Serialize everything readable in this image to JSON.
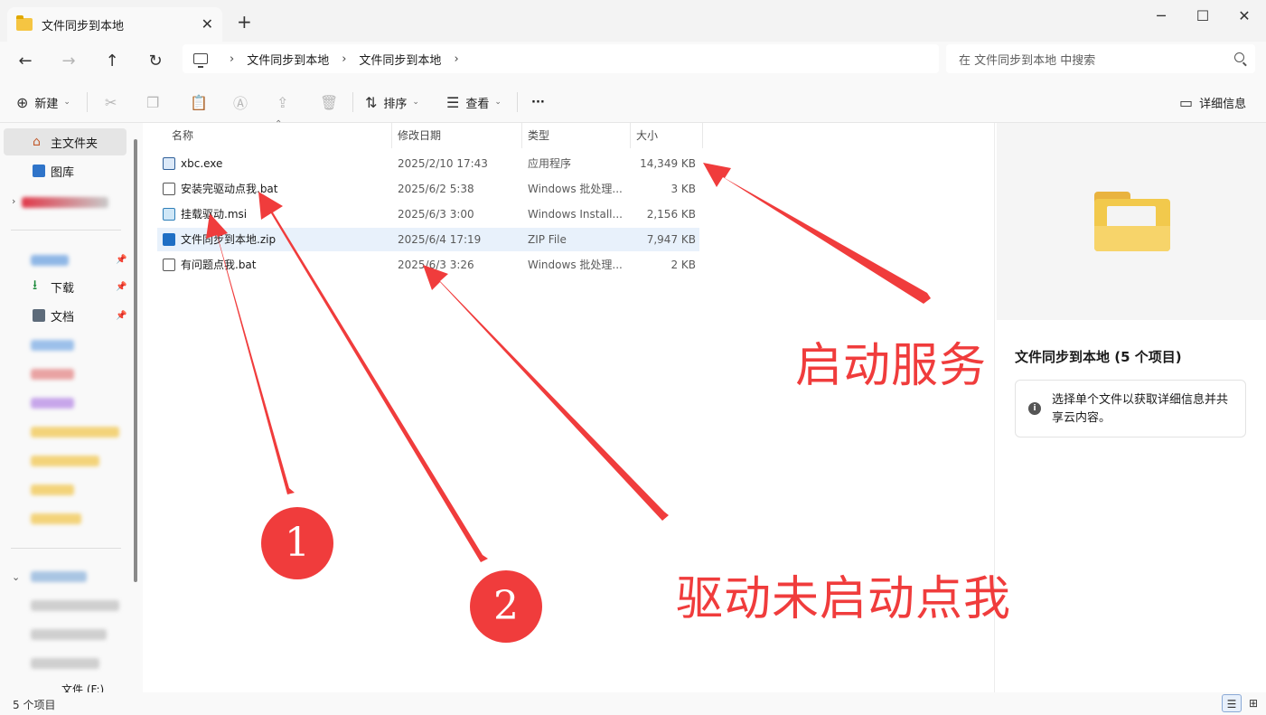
{
  "window": {
    "tab_title": "文件同步到本地",
    "close_tab": "✕",
    "new_tab": "+",
    "controls": {
      "minimize": "─",
      "maximize": "☐",
      "close": "✕"
    }
  },
  "address": {
    "back": "←",
    "forward": "→",
    "up": "↑",
    "refresh": "↻",
    "crumbs": [
      "文件同步到本地",
      "文件同步到本地"
    ],
    "separator": "›",
    "search_placeholder": "在 文件同步到本地 中搜索"
  },
  "toolbar": {
    "new_label": "新建",
    "new_glyph": "⊕",
    "cut": "✂",
    "copy": "❐",
    "paste": "📋",
    "rename": "Ⓐ",
    "share": "⇪",
    "delete": "🗑",
    "sort_label": "排序",
    "sort_glyph": "⇅",
    "view_label": "查看",
    "view_glyph": "☰",
    "more": "···",
    "details_label": "详细信息",
    "details_glyph": "▭"
  },
  "sidebar": {
    "home": "主文件夹",
    "gallery": "图库",
    "downloads": "下载",
    "documents": "文档",
    "pin": "📌",
    "drive_label": "文件 (F:)"
  },
  "columns": {
    "name": "名称",
    "date": "修改日期",
    "type": "类型",
    "size": "大小"
  },
  "files": [
    {
      "name": "xbc.exe",
      "date": "2025/2/10 17:43",
      "type": "应用程序",
      "size": "14,349 KB",
      "icon": "exe-icon"
    },
    {
      "name": "安装完驱动点我.bat",
      "date": "2025/6/2 5:38",
      "type": "Windows 批处理...",
      "size": "3 KB",
      "icon": "bat-icon"
    },
    {
      "name": "挂载驱动.msi",
      "date": "2025/6/3 3:00",
      "type": "Windows Install...",
      "size": "2,156 KB",
      "icon": "msi-icon"
    },
    {
      "name": "文件同步到本地.zip",
      "date": "2025/6/4 17:19",
      "type": "ZIP File",
      "size": "7,947 KB",
      "icon": "zip-icon"
    },
    {
      "name": "有问题点我.bat",
      "date": "2025/6/3 3:26",
      "type": "Windows 批处理...",
      "size": "2 KB",
      "icon": "bat-icon"
    }
  ],
  "preview": {
    "title": "文件同步到本地 (5 个项目)",
    "info_glyph": "i",
    "info_text": "选择单个文件以获取详细信息并共享云内容。"
  },
  "status": {
    "count": "5 个项目",
    "details_view": "☰",
    "tiles_view": "⊞"
  },
  "annotations": {
    "badge1": "1",
    "badge2": "2",
    "start_service": "启动服务",
    "driver_not_started": "驱动未启动点我",
    "color": "#f03c3c"
  }
}
